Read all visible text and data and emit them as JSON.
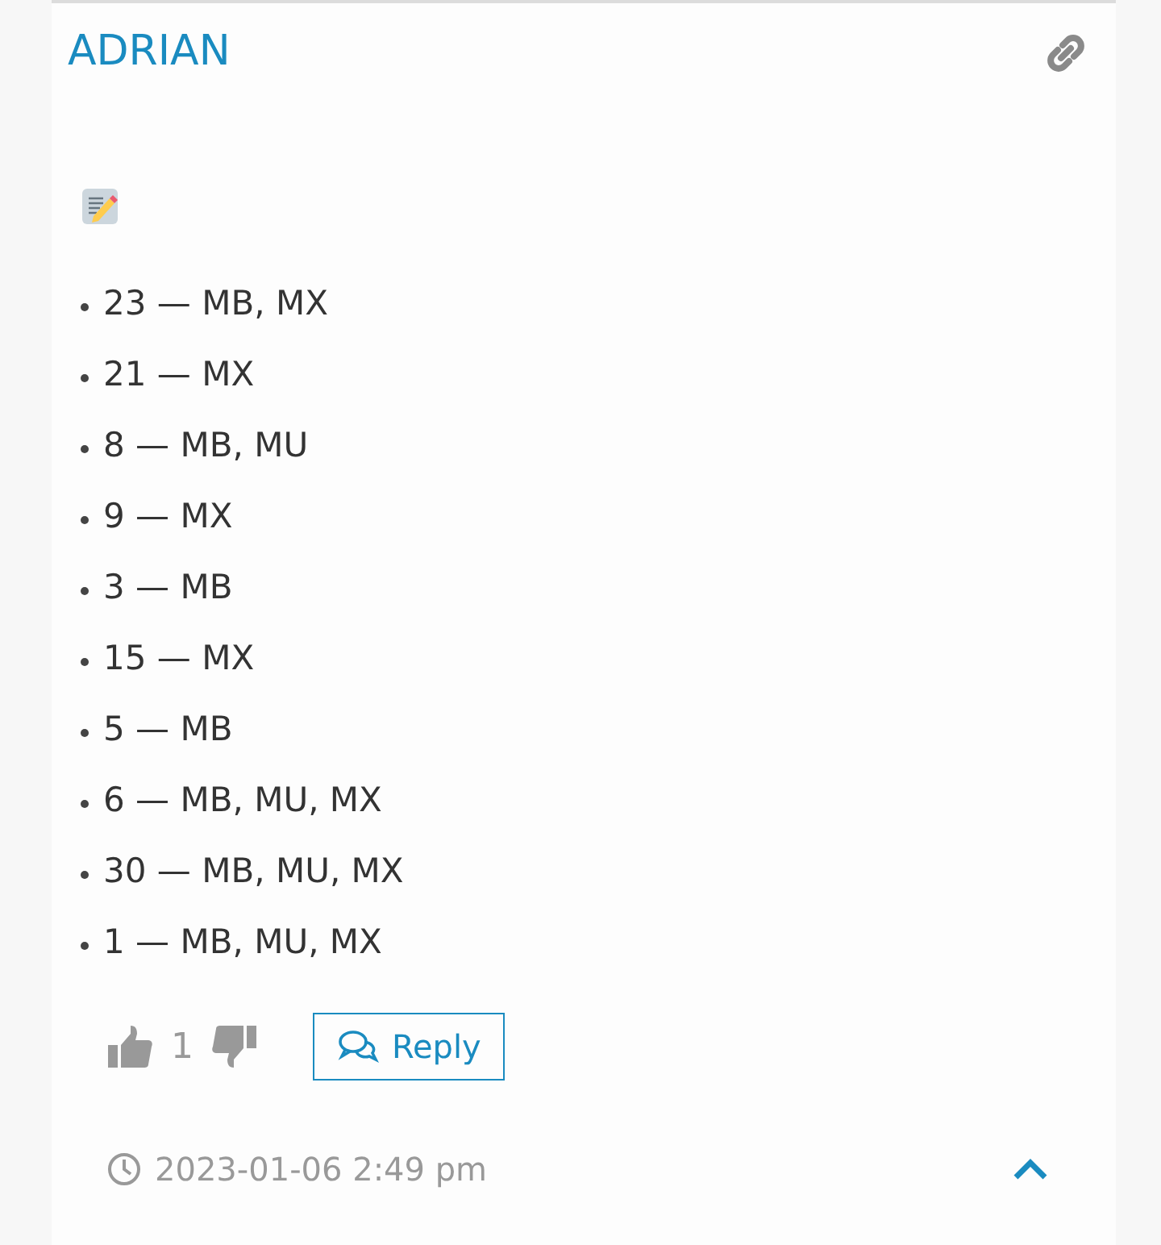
{
  "post": {
    "author": "ADRIAN",
    "items": [
      "23 — MB, MX",
      "21 — MX",
      "8 — MB, MU",
      "9 — MX",
      "3 — MB",
      "15 — MX",
      "5 — MB",
      "6 — MB, MU, MX",
      "30 — MB, MU, MX",
      "1 — MB, MU, MX"
    ],
    "votes": "1",
    "reply": "Reply",
    "timestamp": "2023-01-06 2:49 pm"
  }
}
